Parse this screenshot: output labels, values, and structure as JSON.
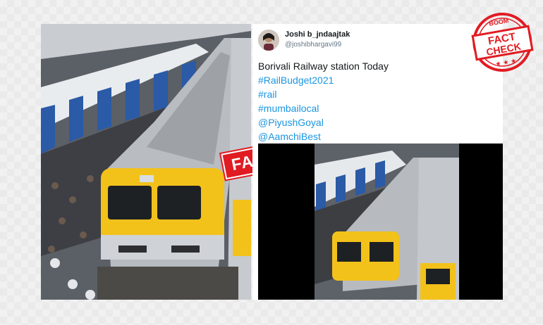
{
  "tweet": {
    "author_name": "Joshi b_jndaajtak",
    "author_handle": "@joshibhargavi99",
    "text_line": "Borivali Railway station Today",
    "links": [
      "#RailBudget2021",
      "#rail",
      "#mumbailocal",
      "@PiyushGoyal",
      "@AamchiBest"
    ]
  },
  "stamps": {
    "fake_label": "FAKE",
    "fact_check_top": "BOOM",
    "fact_check_line1": "FACT",
    "fact_check_line2": "CHECK"
  },
  "colors": {
    "link": "#1b95e0",
    "stamp_red": "#e11b22",
    "train_yellow": "#f2c21b"
  }
}
